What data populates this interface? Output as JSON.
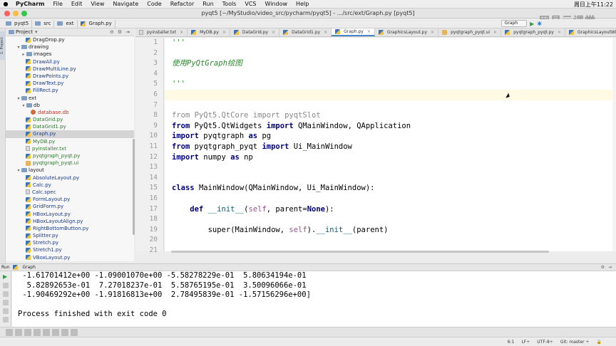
{
  "menubar": {
    "app": "PyCharm",
    "items": [
      "File",
      "Edit",
      "View",
      "Navigate",
      "Code",
      "Refactor",
      "Run",
      "Tools",
      "VCS",
      "Window",
      "Help"
    ],
    "clock": "周日上午11:22"
  },
  "window": {
    "title": "pyqt5 [~/MyStudio/video_src/pycharm/pyqt5] - .../src/ext/Graph.py [pyqt5]"
  },
  "watermark": "网易云课堂",
  "navbar": {
    "crumbs": [
      "pyqt5",
      "src",
      "ext",
      "Graph.py"
    ],
    "run_config": "Graph"
  },
  "project_panel": {
    "title": "Project"
  },
  "left_tool": {
    "label": "1: Project"
  },
  "tree": [
    {
      "label": "DragDrop.py",
      "kind": "py",
      "indent": 4,
      "cls": "plain"
    },
    {
      "label": "drawing",
      "kind": "dir",
      "indent": 2,
      "arrow": "▾",
      "cls": "dir"
    },
    {
      "label": "images",
      "kind": "dir",
      "indent": 3,
      "arrow": "▸",
      "cls": "dir"
    },
    {
      "label": "DrawAll.py",
      "kind": "py",
      "indent": 4,
      "cls": ""
    },
    {
      "label": "DrawMultiLine.py",
      "kind": "py",
      "indent": 4,
      "cls": ""
    },
    {
      "label": "DrawPoints.py",
      "kind": "py",
      "indent": 4,
      "cls": ""
    },
    {
      "label": "DrawText.py",
      "kind": "py",
      "indent": 4,
      "cls": ""
    },
    {
      "label": "FillRect.py",
      "kind": "py",
      "indent": 4,
      "cls": ""
    },
    {
      "label": "ext",
      "kind": "dir",
      "indent": 2,
      "arrow": "▾",
      "cls": "dir"
    },
    {
      "label": "db",
      "kind": "dir",
      "indent": 3,
      "arrow": "▾",
      "cls": "dir"
    },
    {
      "label": "database.db",
      "kind": "db",
      "indent": 5,
      "cls": "red"
    },
    {
      "label": "DataGrid.py",
      "kind": "py",
      "indent": 4,
      "cls": "green"
    },
    {
      "label": "DataGrid1.py",
      "kind": "py",
      "indent": 4,
      "cls": "green"
    },
    {
      "label": "Graph.py",
      "kind": "py",
      "indent": 4,
      "cls": "sel"
    },
    {
      "label": "MyDB.py",
      "kind": "py",
      "indent": 4,
      "cls": "green"
    },
    {
      "label": "pyinstaller.txt",
      "kind": "txt",
      "indent": 4,
      "cls": "green"
    },
    {
      "label": "pyqtgraph_pyqt.py",
      "kind": "py",
      "indent": 4,
      "cls": "green"
    },
    {
      "label": "pyqtgraph_pyqt.ui",
      "kind": "ui",
      "indent": 4,
      "cls": "green"
    },
    {
      "label": "layout",
      "kind": "dir",
      "indent": 2,
      "arrow": "▾",
      "cls": "dir"
    },
    {
      "label": "AbsoluteLayout.py",
      "kind": "py",
      "indent": 4,
      "cls": ""
    },
    {
      "label": "Calc.py",
      "kind": "py",
      "indent": 4,
      "cls": ""
    },
    {
      "label": "Calc.spec",
      "kind": "txt",
      "indent": 4,
      "cls": ""
    },
    {
      "label": "FormLayout.py",
      "kind": "py",
      "indent": 4,
      "cls": ""
    },
    {
      "label": "GridForm.py",
      "kind": "py",
      "indent": 4,
      "cls": ""
    },
    {
      "label": "HBoxLayout.py",
      "kind": "py",
      "indent": 4,
      "cls": ""
    },
    {
      "label": "HBoxLayoutAlign.py",
      "kind": "py",
      "indent": 4,
      "cls": ""
    },
    {
      "label": "RightBottomButton.py",
      "kind": "py",
      "indent": 4,
      "cls": ""
    },
    {
      "label": "Splitter.py",
      "kind": "py",
      "indent": 4,
      "cls": ""
    },
    {
      "label": "Stretch.py",
      "kind": "py",
      "indent": 4,
      "cls": ""
    },
    {
      "label": "Stretch1.py",
      "kind": "py",
      "indent": 4,
      "cls": ""
    },
    {
      "label": "VBoxLayout.py",
      "kind": "py",
      "indent": 4,
      "cls": ""
    }
  ],
  "tabs": [
    {
      "label": "pyinstaller.txt",
      "active": false,
      "kind": "txt"
    },
    {
      "label": "MyDB.py",
      "active": false,
      "kind": "py"
    },
    {
      "label": "DataGrid.py",
      "active": false,
      "kind": "py"
    },
    {
      "label": "DataGrid1.py",
      "active": false,
      "kind": "py"
    },
    {
      "label": "Graph.py",
      "active": true,
      "kind": "py"
    },
    {
      "label": "GraphicsLayout.py",
      "active": false,
      "kind": "py"
    },
    {
      "label": "pyqtgraph_pyqt.ui",
      "active": false,
      "kind": "ui"
    },
    {
      "label": "pyqtgraph_pyqt.py",
      "active": false,
      "kind": "py"
    },
    {
      "label": "GraphicsLayoutWidget.py",
      "active": false,
      "kind": "py"
    }
  ],
  "editor": {
    "line_numbers": [
      "1",
      "2",
      "3",
      "4",
      "5",
      "6",
      "7",
      "8",
      "9",
      "10",
      "11",
      "12",
      "13",
      "14",
      "15",
      "16",
      "17",
      "18",
      "19",
      "20",
      "21"
    ],
    "current_line": 6,
    "lines": [
      [
        {
          "t": "'''",
          "c": "str"
        }
      ],
      [],
      [
        {
          "t": "使用PyQtGraph绘图",
          "c": "str"
        }
      ],
      [],
      [
        {
          "t": "'''",
          "c": "str"
        }
      ],
      [],
      [],
      [
        {
          "t": "from ",
          "c": "grey"
        },
        {
          "t": "PyQt5.QtCore ",
          "c": "grey"
        },
        {
          "t": "import ",
          "c": "grey"
        },
        {
          "t": "pyqtSlot",
          "c": "grey"
        }
      ],
      [
        {
          "t": "from ",
          "c": "kw"
        },
        {
          "t": "PyQt5.QtWidgets ",
          "c": ""
        },
        {
          "t": "import ",
          "c": "kw"
        },
        {
          "t": "QMainWindow, QApplication",
          "c": ""
        }
      ],
      [
        {
          "t": "import ",
          "c": "kw"
        },
        {
          "t": "pyqtgraph ",
          "c": ""
        },
        {
          "t": "as ",
          "c": "kw"
        },
        {
          "t": "pg",
          "c": ""
        }
      ],
      [
        {
          "t": "from ",
          "c": "kw"
        },
        {
          "t": "pyqtgraph_pyqt ",
          "c": ""
        },
        {
          "t": "import ",
          "c": "kw"
        },
        {
          "t": "Ui_MainWindow",
          "c": ""
        }
      ],
      [
        {
          "t": "import ",
          "c": "kw"
        },
        {
          "t": "numpy ",
          "c": ""
        },
        {
          "t": "as ",
          "c": "kw"
        },
        {
          "t": "np",
          "c": ""
        }
      ],
      [],
      [],
      [
        {
          "t": "class ",
          "c": "kw"
        },
        {
          "t": "MainWindow(QMainWindow, Ui_MainWindow):",
          "c": ""
        }
      ],
      [],
      [
        {
          "t": "    def ",
          "c": "kw"
        },
        {
          "t": "__init__",
          "c": "fn"
        },
        {
          "t": "(",
          "c": ""
        },
        {
          "t": "self",
          "c": "self"
        },
        {
          "t": ", parent=",
          "c": ""
        },
        {
          "t": "None",
          "c": "kw"
        },
        {
          "t": "):",
          "c": ""
        }
      ],
      [],
      [
        {
          "t": "        super",
          "c": ""
        },
        {
          "t": "(MainWindow, ",
          "c": ""
        },
        {
          "t": "self",
          "c": "self"
        },
        {
          "t": ").",
          "c": ""
        },
        {
          "t": "__init__",
          "c": "fn"
        },
        {
          "t": "(parent)",
          "c": ""
        }
      ],
      [],
      []
    ]
  },
  "run_panel": {
    "label": "Run",
    "config": "Graph"
  },
  "console": {
    "lines": [
      " -1.61701412e+00 -1.09001070e+00 -5.58278229e-01  5.80634194e-01",
      "  5.82892653e-01  7.27018237e-01  5.58765195e-01  3.50096066e-01",
      " -1.90469292e+00 -1.91816813e+00  2.78495839e-01 -1.57156296e+00]",
      "",
      "Process finished with exit code 0"
    ]
  },
  "statusbar": {
    "position": "6:1",
    "line_sep": "LF÷",
    "encoding": "UTF-8÷",
    "vcs": "Git: master ÷"
  },
  "colors": {
    "accent": "#4a88c7",
    "selection": "#d4d4d4",
    "current_line": "#fffae3"
  }
}
